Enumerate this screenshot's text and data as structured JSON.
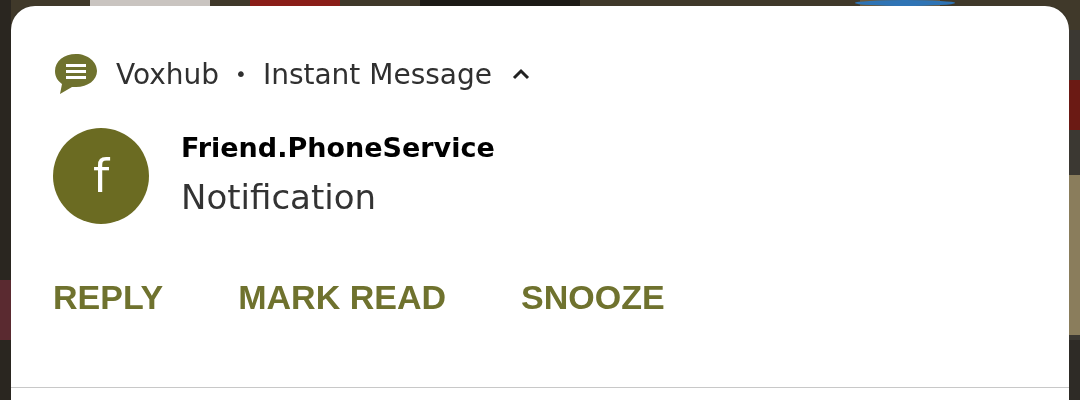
{
  "notification": {
    "app_name": "Voxhub",
    "separator": "•",
    "channel": "Instant Message",
    "expanded": true,
    "avatar_letter": "f",
    "title": "Friend.PhoneService",
    "body": "Notification",
    "actions": [
      {
        "label": "REPLY"
      },
      {
        "label": "MARK READ"
      },
      {
        "label": "SNOOZE"
      }
    ]
  }
}
